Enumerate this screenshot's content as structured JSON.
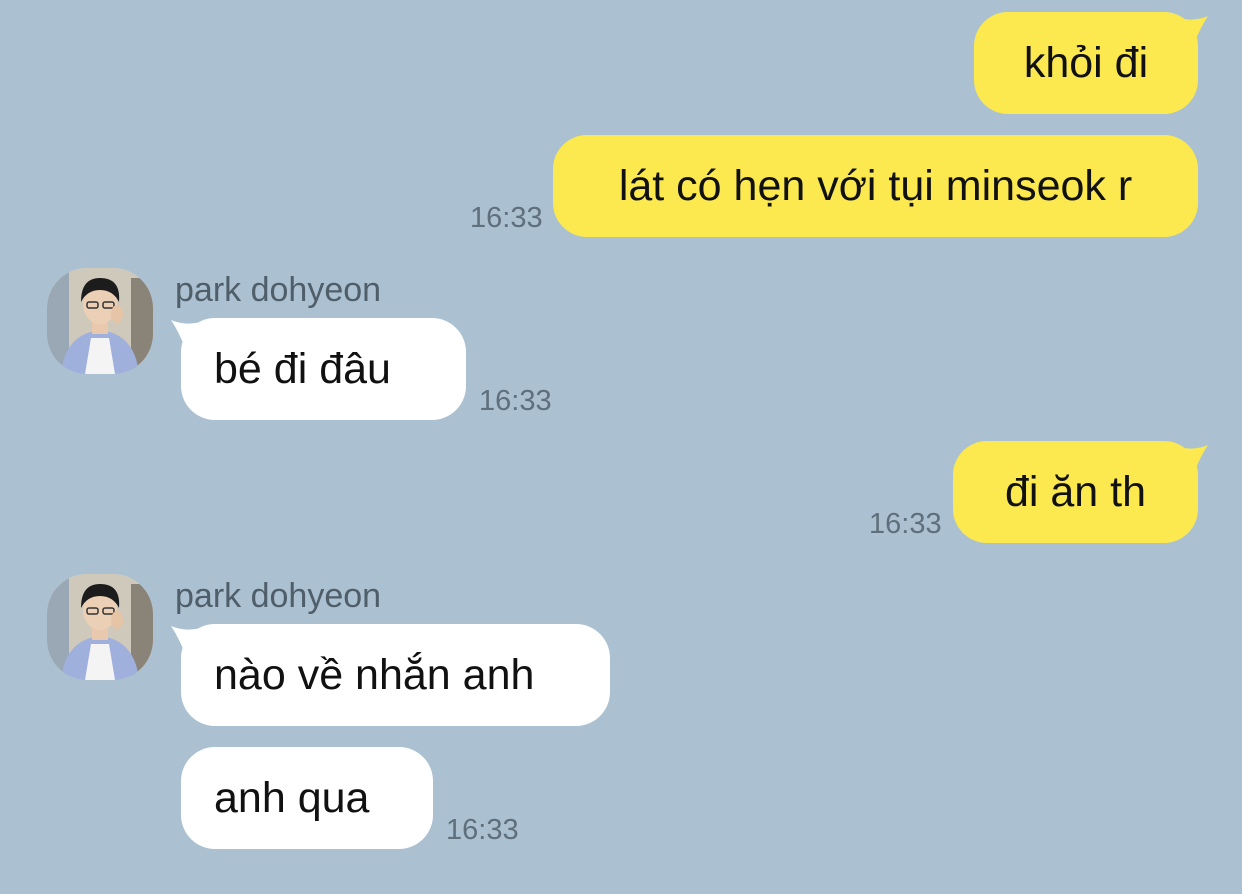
{
  "chat": {
    "bg_color": "#abc1d1",
    "outgoing_color": "#fbe94f",
    "incoming_color": "#ffffff",
    "messages": [
      {
        "direction": "out",
        "text": "khỏi đi"
      },
      {
        "direction": "out",
        "text": "lát có hẹn với tụi minseok r",
        "time": "16:33"
      },
      {
        "direction": "in",
        "sender": "park dohyeon",
        "text": "bé đi đâu",
        "time": "16:33"
      },
      {
        "direction": "out",
        "text": "đi ăn th",
        "time": "16:33"
      },
      {
        "direction": "in",
        "sender": "park dohyeon",
        "text": "nào về nhắn anh"
      },
      {
        "direction": "in",
        "text": "anh qua",
        "time": "16:33"
      }
    ]
  }
}
